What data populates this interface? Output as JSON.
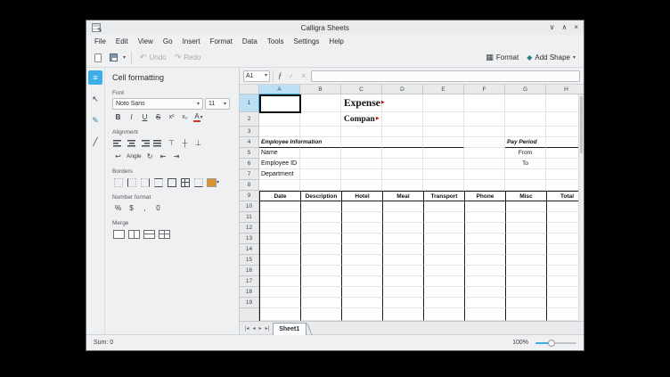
{
  "titlebar": {
    "title": "Calligra Sheets"
  },
  "icons": {
    "minimize": "∨",
    "maximize": "∧",
    "close": "×",
    "caret": "▾",
    "undo": "↶",
    "redo": "↷",
    "format_grid": "▦",
    "add_shape": "◆",
    "fx": "ƒ",
    "apply": "✓",
    "cancel": "✕",
    "bold": "B",
    "italic": "I",
    "underline": "U",
    "strike": "S",
    "superscript": "x²",
    "subscript": "x₂",
    "font_color": "A",
    "valign_top": "⊤",
    "valign_middle": "┼",
    "valign_bottom": "⊥",
    "wrap": "↩",
    "rotate": "↻",
    "indent_less": "⇤",
    "indent_more": "⇥",
    "percent": "%",
    "currency": "$",
    "thousands": ",",
    "precision": "0",
    "format_tool": "≡",
    "selection_tool": "↖",
    "pen_tool": "✎",
    "line_tool": "╱",
    "overflow": "▶",
    "tab_first": "|◂",
    "tab_prev": "◂",
    "tab_next": "▸",
    "tab_last": "▸|"
  },
  "menubar": {
    "items": [
      "File",
      "Edit",
      "View",
      "Go",
      "Insert",
      "Format",
      "Data",
      "Tools",
      "Settings",
      "Help"
    ]
  },
  "toolbar": {
    "undo": "Undo",
    "redo": "Redo",
    "format": "Format",
    "add_shape": "Add Shape"
  },
  "panel": {
    "title": "Cell formatting",
    "font_label": "Font",
    "font_family": "Noto Sans",
    "font_size": "11",
    "alignment_label": "Alignment",
    "angle_label": "Angle",
    "borders_label": "Borders",
    "number_label": "Number format",
    "merge_label": "Merge"
  },
  "formula_bar": {
    "cell_ref": "A1"
  },
  "sheet": {
    "columns": [
      "A",
      "B",
      "C",
      "D",
      "E",
      "F",
      "G",
      "H"
    ],
    "row_numbers": [
      "1",
      "2",
      "3",
      "4",
      "5",
      "6",
      "7",
      "8",
      "9",
      "10",
      "11",
      "12",
      "13",
      "14",
      "15",
      "16",
      "17",
      "18",
      "19"
    ],
    "cells": {
      "title": "Expense",
      "subtitle": "Compan",
      "employee_information": "Employee Information",
      "pay_period": "Pay Period",
      "name": "Name",
      "from": "From",
      "employee_id": "Employee ID",
      "to": "To",
      "department": "Department"
    },
    "table_headers": [
      "Date",
      "Description",
      "Hotel",
      "Meal",
      "Transport",
      "Phone",
      "Misc",
      "Total"
    ],
    "tab_name": "Sheet1"
  },
  "statusbar": {
    "sum": "Sum: 0",
    "zoom": "100%"
  }
}
